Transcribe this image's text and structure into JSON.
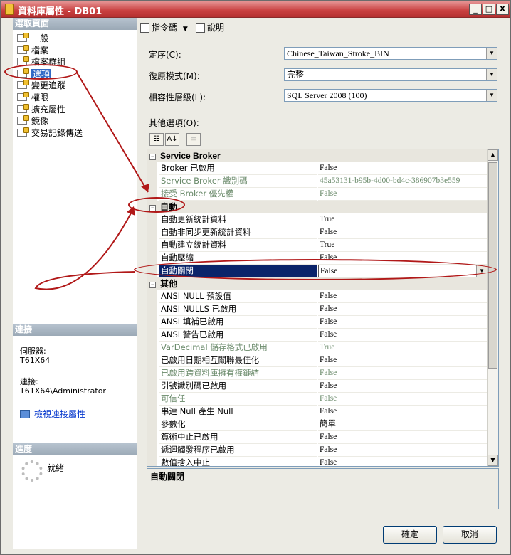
{
  "window": {
    "title": "資料庫屬性 - DB01",
    "controls": [
      "_",
      "□",
      "X"
    ]
  },
  "left": {
    "header": "選取頁面",
    "pages": [
      "一般",
      "檔案",
      "檔案群組",
      "選項",
      "變更追蹤",
      "權限",
      "擴充屬性",
      "鏡像",
      "交易記錄傳送"
    ],
    "selected_index": 3,
    "connection_header": "連接",
    "server_label": "伺服器:",
    "server_value": "T61X64",
    "connection_label": "連接:",
    "connection_value": "T61X64\\Administrator",
    "view_link": "檢視連接屬性",
    "progress_header": "進度",
    "progress_status": "就緒"
  },
  "toolbar": {
    "script_label": "指令碼",
    "help_label": "說明"
  },
  "fields": {
    "collation_label": "定序(C):",
    "collation_value": "Chinese_Taiwan_Stroke_BIN",
    "recovery_label": "復原模式(M):",
    "recovery_value": "完整",
    "compat_label": "相容性層級(L):",
    "compat_value": "SQL Server 2008 (100)",
    "other_options_label": "其他選項(O):"
  },
  "grid": {
    "categories": {
      "service_broker": "Service Broker",
      "auto": "自動",
      "other": "其他"
    },
    "service_broker_rows": [
      {
        "name": "Broker 已啟用",
        "value": "False"
      },
      {
        "name": "Service Broker 識別碼",
        "value": "45a53131-b95b-4d00-bd4c-386907b3e559"
      },
      {
        "name": "接受 Broker 優先權",
        "value": "False"
      }
    ],
    "auto_rows": [
      {
        "name": "自動更新統計資料",
        "value": "True"
      },
      {
        "name": "自動非同步更新統計資料",
        "value": "False"
      },
      {
        "name": "自動建立統計資料",
        "value": "True"
      },
      {
        "name": "自動壓縮",
        "value": "False"
      },
      {
        "name": "自動關閉",
        "value": "False"
      }
    ],
    "other_rows": [
      {
        "name": "ANSI NULL 預設值",
        "value": "False"
      },
      {
        "name": "ANSI NULLS 已啟用",
        "value": "False"
      },
      {
        "name": "ANSI 填補已啟用",
        "value": "False"
      },
      {
        "name": "ANSI 警告已啟用",
        "value": "False"
      },
      {
        "name": "VarDecimal 儲存格式已啟用",
        "value": "True"
      },
      {
        "name": "已啟用日期相互關聯最佳化",
        "value": "False"
      },
      {
        "name": "已啟用跨資料庫擁有權鏈結",
        "value": "False"
      },
      {
        "name": "引號識別碼已啟用",
        "value": "False"
      },
      {
        "name": "可信任",
        "value": "False"
      },
      {
        "name": "串連 Null 產生 Null",
        "value": "False"
      },
      {
        "name": "參數化",
        "value": "簡單"
      },
      {
        "name": "算術中止已啟用",
        "value": "False"
      },
      {
        "name": "遞迴觸發程序已啟用",
        "value": "False"
      },
      {
        "name": "數值捨入中止",
        "value": "False"
      }
    ],
    "description": "自動關閉"
  },
  "buttons": {
    "ok": "確定",
    "cancel": "取消"
  },
  "colors": {
    "titlebar": "#c94040",
    "selection": "#0a246a",
    "annotation": "#b11818"
  }
}
